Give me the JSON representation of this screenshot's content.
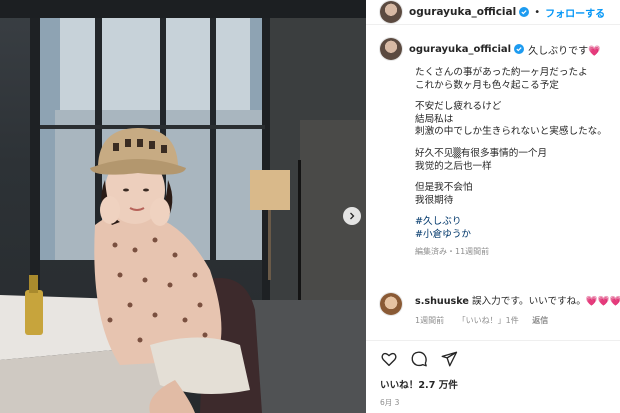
{
  "post": {
    "username": "ogurayuka_official",
    "follow_label": "フォローする",
    "caption_lead": "久しぶりです💗",
    "caption_lines": [
      "たくさんの事があった約一ヶ月だったよ",
      "これから数ヶ月も色々起こる予定",
      "",
      "不安だし疲れるけど",
      "結局私は",
      "刺激の中でしか生きられないと実感したな。",
      "",
      "好久不见▒有很多事情的一个月",
      "我觉的之后也一样",
      "",
      "但是我不会怕",
      "我很期待"
    ],
    "hashtags": [
      "#久しぶり",
      "#小倉ゆうか"
    ],
    "caption_meta": "編集済み・11週間前",
    "likes": "いいね！2.7 万件",
    "date": "6月 3"
  },
  "comment": {
    "username": "s.shuuske",
    "text": "誤入力です。いいですね。💗💗💗",
    "time": "1週間前",
    "likes": "「いいね！」1件",
    "reply": "返信"
  },
  "colors": {
    "accent": "#0095f6",
    "hashtag": "#00376b",
    "muted": "#8e8e8e",
    "verified": "#1d9bf0"
  },
  "icons": [
    "verified-badge-icon",
    "heart-icon",
    "comment-icon",
    "share-icon",
    "chevron-right-icon"
  ]
}
